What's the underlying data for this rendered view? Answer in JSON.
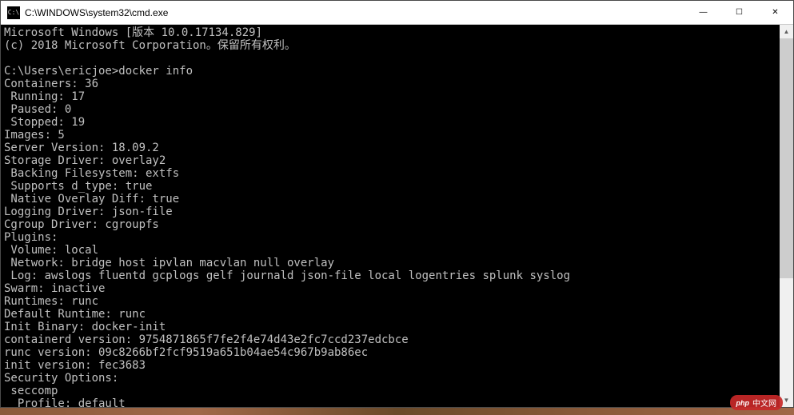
{
  "window": {
    "icon_label": "C:\\",
    "title": "C:\\WINDOWS\\system32\\cmd.exe"
  },
  "controls": {
    "minimize": "—",
    "maximize": "☐",
    "close": "✕"
  },
  "terminal": {
    "lines": [
      "Microsoft Windows [版本 10.0.17134.829]",
      "(c) 2018 Microsoft Corporation。保留所有权利。",
      "",
      "C:\\Users\\ericjoe>docker info",
      "Containers: 36",
      " Running: 17",
      " Paused: 0",
      " Stopped: 19",
      "Images: 5",
      "Server Version: 18.09.2",
      "Storage Driver: overlay2",
      " Backing Filesystem: extfs",
      " Supports d_type: true",
      " Native Overlay Diff: true",
      "Logging Driver: json-file",
      "Cgroup Driver: cgroupfs",
      "Plugins:",
      " Volume: local",
      " Network: bridge host ipvlan macvlan null overlay",
      " Log: awslogs fluentd gcplogs gelf journald json-file local logentries splunk syslog",
      "Swarm: inactive",
      "Runtimes: runc",
      "Default Runtime: runc",
      "Init Binary: docker-init",
      "containerd version: 9754871865f7fe2f4e74d43e2fc7ccd237edcbce",
      "runc version: 09c8266bf2fcf9519a651b04ae54c967b9ab86ec",
      "init version: fec3683",
      "Security Options:",
      " seccomp",
      "  Profile: default"
    ]
  },
  "scrollbar": {
    "up": "▲",
    "down": "▼"
  },
  "watermark": {
    "logo": "php",
    "text": "中文网"
  }
}
